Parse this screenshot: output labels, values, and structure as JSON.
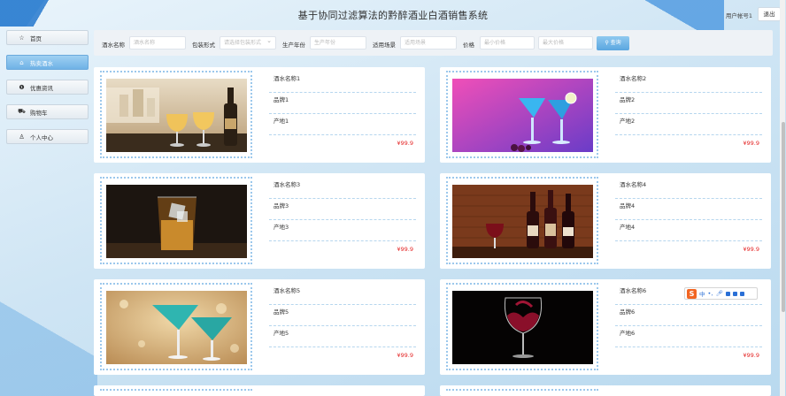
{
  "header": {
    "title": "基于协同过滤算法的黔醉酒业白酒销售系统",
    "user_label": "用户帐号1",
    "logout_label": "退出"
  },
  "sidebar": {
    "items": [
      {
        "label": "首页",
        "icon": "star-icon",
        "active": false
      },
      {
        "label": "热卖酒水",
        "icon": "home-icon",
        "active": true
      },
      {
        "label": "优惠资讯",
        "icon": "info-icon",
        "active": false
      },
      {
        "label": "购物车",
        "icon": "cart-icon",
        "active": false
      },
      {
        "label": "个人中心",
        "icon": "user-icon",
        "active": false
      }
    ]
  },
  "filter": {
    "name_label": "酒水名称",
    "name_placeholder": "酒水名称",
    "pack_label": "包装形式",
    "pack_placeholder": "请选择包装形式",
    "date_label": "生产年份",
    "date_placeholder": "生产年份",
    "scene_label": "适用场景",
    "scene_placeholder": "适用场景",
    "price_label": "价格",
    "min_placeholder": "最小价格",
    "max_placeholder": "最大价格",
    "search_label": "查询"
  },
  "products": [
    {
      "name": "酒水名称1",
      "brand": "品牌1",
      "origin": "产地1",
      "price": "¥99.9",
      "image": "wine-glasses-window"
    },
    {
      "name": "酒水名称2",
      "brand": "品牌2",
      "origin": "产地2",
      "price": "¥99.9",
      "image": "blue-cocktails-pink"
    },
    {
      "name": "酒水名称3",
      "brand": "品牌3",
      "origin": "产地3",
      "price": "¥99.9",
      "image": "whisky-ice"
    },
    {
      "name": "酒水名称4",
      "brand": "品牌4",
      "origin": "产地4",
      "price": "¥99.9",
      "image": "wine-bottles-brick"
    },
    {
      "name": "酒水名称5",
      "brand": "品牌5",
      "origin": "产地5",
      "price": "¥99.9",
      "image": "green-cocktails-bokeh"
    },
    {
      "name": "酒水名称6",
      "brand": "品牌6",
      "origin": "产地6",
      "price": "¥99.9",
      "image": "red-wine-splash"
    }
  ],
  "ime_toolbar": {
    "logo": "S",
    "mode": "中"
  },
  "colors": {
    "price": "#e42424",
    "accent": "#5aa6e0",
    "divider": "#b6d6ee"
  }
}
